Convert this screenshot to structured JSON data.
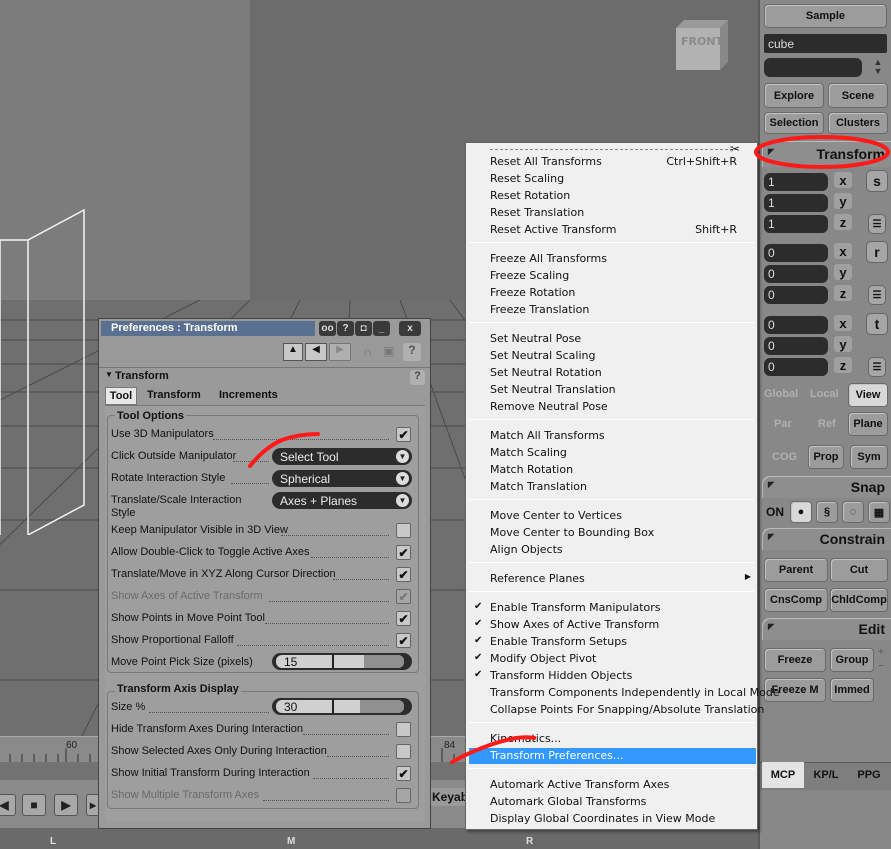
{
  "viewport": {
    "front_label": "FRONT",
    "timeline_ticks": [
      "60",
      "84"
    ]
  },
  "transport": {
    "keyable_label": "Keyab"
  },
  "bottom_bar": {
    "labels": [
      "L",
      "M",
      "R"
    ]
  },
  "mcp": {
    "sample_label": "Sample",
    "object_name": "cube",
    "buttons_row1": [
      "Explore",
      "Scene"
    ],
    "buttons_row2": [
      "Selection",
      "Clusters"
    ],
    "transform_header": "Transform",
    "scale": {
      "values": [
        "1",
        "1",
        "1"
      ],
      "axes": [
        "x",
        "y",
        "z"
      ],
      "button": "s"
    },
    "rotation": {
      "values": [
        "0",
        "0",
        "0"
      ],
      "axes": [
        "x",
        "y",
        "z"
      ],
      "button": "r"
    },
    "translation": {
      "values": [
        "0",
        "0",
        "0"
      ],
      "axes": [
        "x",
        "y",
        "z"
      ],
      "button": "t"
    },
    "space_buttons": [
      "Global",
      "Local",
      "View"
    ],
    "ref_buttons": [
      "Par",
      "Ref",
      "Plane"
    ],
    "cog_buttons": [
      "COG",
      "Prop",
      "Sym"
    ],
    "snap_header": "Snap",
    "snap_on": "ON",
    "constrain_header": "Constrain",
    "constrain_row1": [
      "Parent",
      "Cut"
    ],
    "constrain_row2": [
      "CnsComp",
      "ChldComp"
    ],
    "edit_header": "Edit",
    "edit_row1": [
      "Freeze",
      "Group"
    ],
    "edit_row2": [
      "Freeze M",
      "Immed"
    ],
    "tabs": [
      "MCP",
      "KP/L",
      "PPG"
    ]
  },
  "prefs": {
    "title": "Preferences : Transform",
    "section": "Transform",
    "tabs": [
      "Tool",
      "Transform",
      "Increments"
    ],
    "tool_options_label": "Tool Options",
    "rows": [
      {
        "label": "Use 3D Manipulators",
        "checked": true,
        "dim": false
      },
      {
        "label": "Click Outside Manipulator",
        "dropdown": "Select Tool"
      },
      {
        "label": "Rotate Interaction Style",
        "dropdown": "Spherical"
      },
      {
        "label": "Translate/Scale Interaction",
        "label2": "Style",
        "dropdown": "Axes + Planes"
      },
      {
        "label": "Keep Manipulator Visible in 3D View",
        "checked": false,
        "dim": false
      },
      {
        "label": "Allow Double-Click to Toggle Active Axes",
        "checked": true,
        "dim": false
      },
      {
        "label": "Translate/Move in XYZ Along Cursor Direction",
        "checked": true,
        "dim": false
      },
      {
        "label": "Show Axes of Active Transform",
        "checked": true,
        "dim": true
      },
      {
        "label": "Show Points in Move Point Tool",
        "checked": true,
        "dim": false
      },
      {
        "label": "Show Proportional Falloff",
        "checked": true,
        "dim": false
      },
      {
        "label": "Move Point Pick Size (pixels)",
        "slider": "15"
      }
    ],
    "axis_display_label": "Transform Axis Display",
    "axis_rows": [
      {
        "label": "Size %",
        "slider": "30"
      },
      {
        "label": "Hide Transform Axes During Interaction",
        "checked": false,
        "dim": false
      },
      {
        "label": "Show Selected Axes Only During Interaction",
        "checked": false,
        "dim": false
      },
      {
        "label": "Show Initial Transform During Interaction",
        "checked": true,
        "dim": false
      },
      {
        "label": "Show Multiple Transform Axes",
        "checked": false,
        "dim": true
      }
    ]
  },
  "menu": {
    "tearoff_icon": "scissors-icon",
    "groups": [
      [
        {
          "label": "Reset All Transforms",
          "shortcut": "Ctrl+Shift+R"
        },
        {
          "label": "Reset Scaling"
        },
        {
          "label": "Reset Rotation"
        },
        {
          "label": "Reset Translation"
        },
        {
          "label": "Reset Active Transform",
          "shortcut": "Shift+R"
        }
      ],
      [
        {
          "label": "Freeze All Transforms"
        },
        {
          "label": "Freeze Scaling"
        },
        {
          "label": "Freeze Rotation"
        },
        {
          "label": "Freeze Translation"
        }
      ],
      [
        {
          "label": "Set Neutral Pose"
        },
        {
          "label": "Set Neutral Scaling"
        },
        {
          "label": "Set Neutral Rotation"
        },
        {
          "label": "Set Neutral Translation"
        },
        {
          "label": "Remove Neutral Pose"
        }
      ],
      [
        {
          "label": "Match All Transforms"
        },
        {
          "label": "Match Scaling"
        },
        {
          "label": "Match Rotation"
        },
        {
          "label": "Match Translation"
        }
      ],
      [
        {
          "label": "Move Center to Vertices"
        },
        {
          "label": "Move Center to Bounding Box"
        },
        {
          "label": "Align Objects"
        }
      ],
      [
        {
          "label": "Reference Planes",
          "submenu": true
        }
      ],
      [
        {
          "label": "Enable Transform Manipulators",
          "checked": true
        },
        {
          "label": "Show Axes of Active Transform",
          "checked": true
        },
        {
          "label": "Enable Transform Setups",
          "checked": true
        },
        {
          "label": "Modify Object Pivot",
          "checked": true
        },
        {
          "label": "Transform Hidden Objects",
          "checked": true
        },
        {
          "label": "Transform Components Independently in Local Mode"
        },
        {
          "label": "Collapse Points For Snapping/Absolute Translation"
        }
      ],
      [
        {
          "label": "Kinematics..."
        },
        {
          "label": "Transform Preferences...",
          "highlighted": true
        }
      ],
      [
        {
          "label": "Automark Active Transform Axes"
        },
        {
          "label": "Automark Global Transforms"
        },
        {
          "label": "Display Global Coordinates in View Mode"
        }
      ]
    ]
  },
  "colors": {
    "annotation": "#ff1a1a",
    "highlight": "#3399ff",
    "title_bar": "#5a7090"
  }
}
